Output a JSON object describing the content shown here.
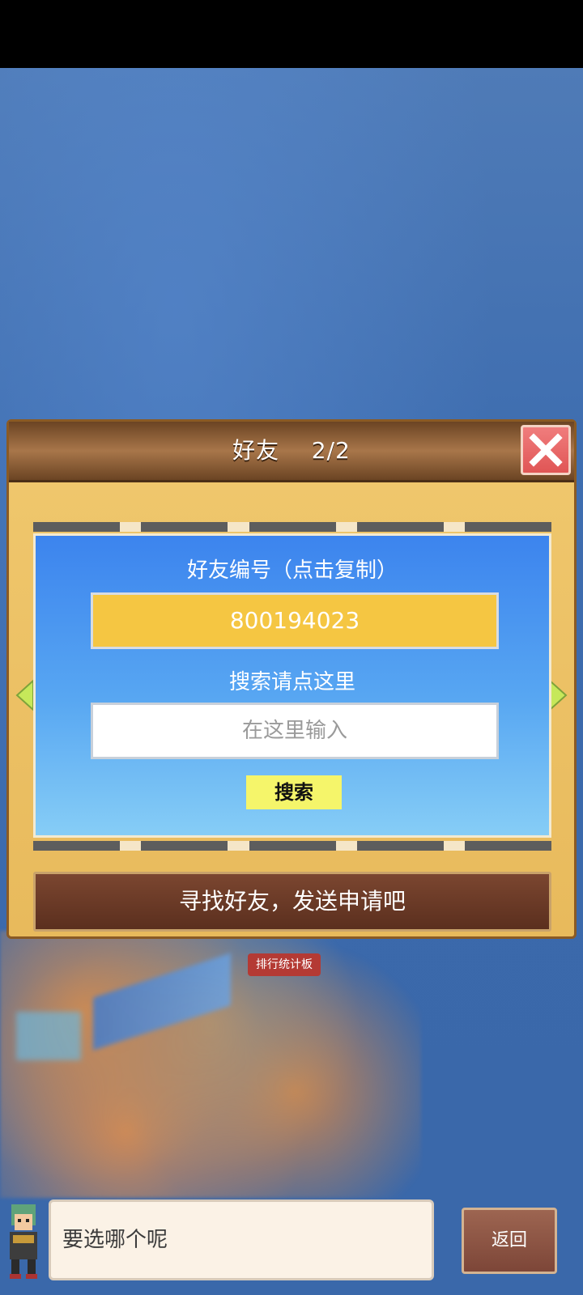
{
  "panel": {
    "title": "好友",
    "page": "2/2",
    "friend_id_label": "好友编号（点击复制）",
    "friend_id_value": "800194023",
    "search_label": "搜索请点这里",
    "search_placeholder": "在这里输入",
    "search_button": "搜索",
    "banner_text": "寻找好友，发送申请吧"
  },
  "background": {
    "sign_text": "排行统计板"
  },
  "dialog": {
    "text": "要选哪个呢",
    "back_button": "返回"
  },
  "colors": {
    "accent_yellow": "#f5c642",
    "close_red": "#e05555",
    "card_blue": "#3c84ee"
  }
}
